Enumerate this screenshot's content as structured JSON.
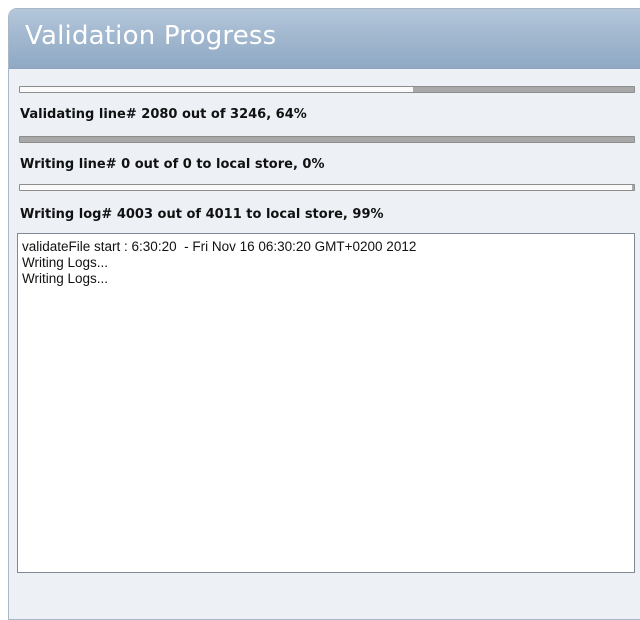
{
  "window": {
    "title": "Validation Progress"
  },
  "progress": {
    "validating": {
      "label": "Validating line# 2080 out of 3246, 64%",
      "percent": 64
    },
    "writing_lines": {
      "label": "Writing line# 0 out of 0 to local store, 0%",
      "percent": 0
    },
    "writing_logs": {
      "label": "Writing log# 4003 out of 4011 to local store, 99%",
      "percent": 99
    }
  },
  "log": {
    "lines": [
      "validateFile start : 6:30:20  - Fri Nov 16 06:30:20 GMT+0200 2012",
      "Writing Logs...",
      "Writing Logs..."
    ]
  },
  "colors": {
    "title_bar": "#a2b8cf",
    "panel_background": "#edf1f6",
    "bar_fill": "#a8a8a8"
  }
}
